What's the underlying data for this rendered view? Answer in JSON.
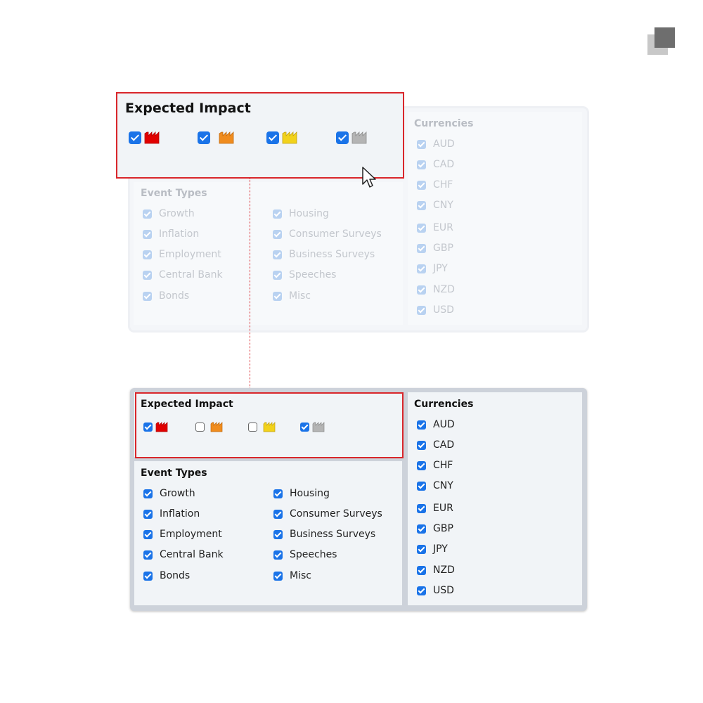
{
  "colors": {
    "checkbox": "#1a73e8",
    "highlight": "#d9262b",
    "impact_high": "#e10000",
    "impact_medium": "#f08c1e",
    "impact_low": "#f2d21b",
    "impact_none": "#b4b4b4"
  },
  "callout": {
    "title": "Expected Impact",
    "items": [
      {
        "icon": "factory-red-icon",
        "checked": true
      },
      {
        "icon": "factory-orange-icon",
        "checked": true
      },
      {
        "icon": "factory-yellow-icon",
        "checked": true
      },
      {
        "icon": "factory-gray-icon",
        "checked": true
      }
    ]
  },
  "faded_panel": {
    "event_types_title": "Event Types",
    "currencies_title": "Currencies",
    "event_types_left": [
      "Growth",
      "Inflation",
      "Employment",
      "Central Bank",
      "Bonds"
    ],
    "event_types_right": [
      "Housing",
      "Consumer Surveys",
      "Business Surveys",
      "Speeches",
      "Misc"
    ],
    "currencies": [
      "AUD",
      "CAD",
      "CHF",
      "CNY",
      "EUR",
      "GBP",
      "JPY",
      "NZD",
      "USD"
    ]
  },
  "active_panel": {
    "impact_title": "Expected Impact",
    "impact_items": [
      {
        "icon": "factory-red-icon",
        "checked": true
      },
      {
        "icon": "factory-orange-icon",
        "checked": false
      },
      {
        "icon": "factory-yellow-icon",
        "checked": false
      },
      {
        "icon": "factory-gray-icon",
        "checked": true
      }
    ],
    "event_types_title": "Event Types",
    "currencies_title": "Currencies",
    "event_types_left": [
      "Growth",
      "Inflation",
      "Employment",
      "Central Bank",
      "Bonds"
    ],
    "event_types_right": [
      "Housing",
      "Consumer Surveys",
      "Business Surveys",
      "Speeches",
      "Misc"
    ],
    "currencies": [
      "AUD",
      "CAD",
      "CHF",
      "CNY",
      "EUR",
      "GBP",
      "JPY",
      "NZD",
      "USD"
    ]
  }
}
